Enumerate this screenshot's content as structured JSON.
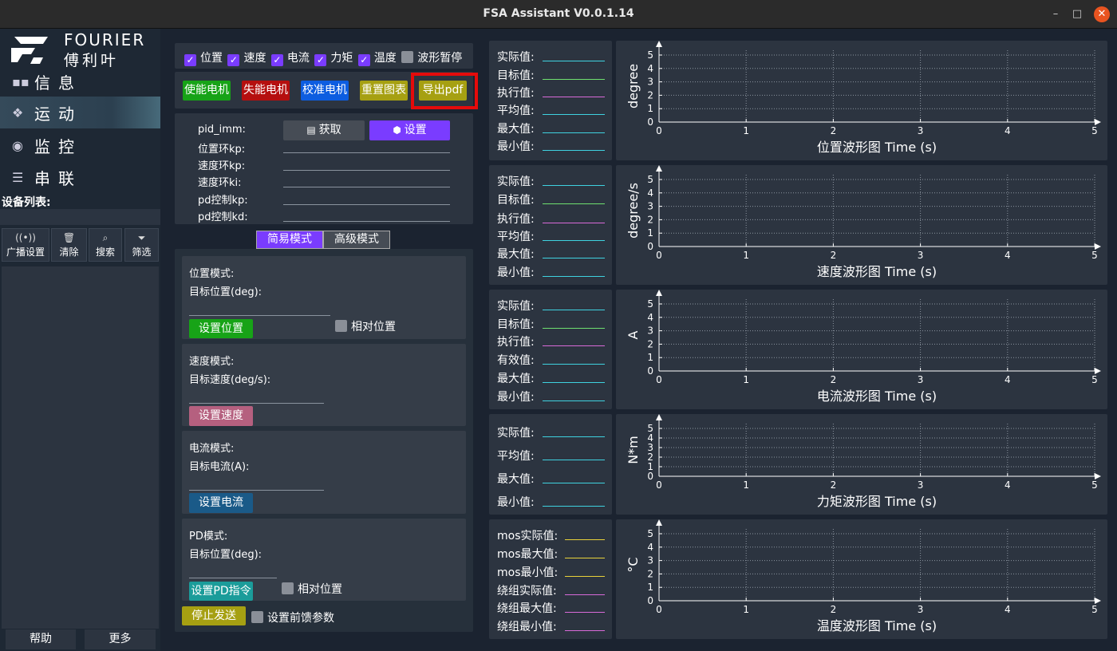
{
  "window": {
    "title": "FSA Assistant V0.0.1.14",
    "minimize": "–",
    "maximize": "□",
    "close": "✕"
  },
  "logo": {
    "brand": "FOURIER",
    "brand_cn": "傅利叶"
  },
  "nav": [
    {
      "icon": "grid-icon",
      "label": "信息",
      "active": false
    },
    {
      "icon": "motion-icon",
      "label": "运动",
      "active": true
    },
    {
      "icon": "monitor-icon",
      "label": "监控",
      "active": false
    },
    {
      "icon": "sliders-icon",
      "label": "串联",
      "active": false
    }
  ],
  "device_list": {
    "label": "设备列表:"
  },
  "side_buttons": [
    {
      "icon": "broadcast-icon",
      "label": "广播设置"
    },
    {
      "icon": "trash-icon",
      "label": "清除"
    },
    {
      "icon": "search-icon",
      "label": "搜索"
    },
    {
      "icon": "filter-icon",
      "label": "筛选"
    }
  ],
  "bottom_buttons": {
    "help": "帮助",
    "more": "更多"
  },
  "wave_toggles": [
    {
      "label": "位置",
      "checked": true
    },
    {
      "label": "速度",
      "checked": true
    },
    {
      "label": "电流",
      "checked": true
    },
    {
      "label": "力矩",
      "checked": true
    },
    {
      "label": "温度",
      "checked": true
    },
    {
      "label": "波形暂停",
      "checked": false
    }
  ],
  "motor_buttons": [
    {
      "label": "使能电机",
      "color": "#17a317"
    },
    {
      "label": "失能电机",
      "color": "#b50f0f"
    },
    {
      "label": "校准电机",
      "color": "#0d5de0"
    },
    {
      "label": "重置图表",
      "color": "#a6a012"
    },
    {
      "label": "导出pdf",
      "color": "#a6a012"
    }
  ],
  "pid": {
    "fields": [
      "pid_imm:",
      "位置环kp:",
      "速度环kp:",
      "速度环ki:",
      "pd控制kp:",
      "pd控制kd:"
    ],
    "get_label": "获取",
    "set_label": "设置"
  },
  "mode_tabs": {
    "simple": "简易模式",
    "advanced": "高级模式"
  },
  "modes": {
    "position": {
      "title": "位置模式:",
      "target": "目标位置(deg):",
      "button": "设置位置",
      "relative": "相对位置"
    },
    "velocity": {
      "title": "速度模式:",
      "target": "目标速度(deg/s):",
      "button": "设置速度"
    },
    "current": {
      "title": "电流模式:",
      "target": "目标电流(A):",
      "button": "设置电流"
    },
    "pd": {
      "title": "PD模式:",
      "target": "目标位置(deg):",
      "button": "设置PD指令",
      "relative": "相对位置"
    }
  },
  "footer_controls": {
    "stop": "停止发送",
    "feedforward": "设置前馈参数"
  },
  "stat_panels": [
    {
      "rows": [
        {
          "label": "实际值:",
          "color": "#3fd2e0"
        },
        {
          "label": "目标值:",
          "color": "#6fe070"
        },
        {
          "label": "执行值:",
          "color": "#d96ad9"
        },
        {
          "label": "平均值:",
          "color": "#3fd2e0"
        },
        {
          "label": "最大值:",
          "color": "#3fd2e0"
        },
        {
          "label": "最小值:",
          "color": "#3fd2e0"
        }
      ]
    },
    {
      "rows": [
        {
          "label": "实际值:",
          "color": "#3fd2e0"
        },
        {
          "label": "目标值:",
          "color": "#6fe070"
        },
        {
          "label": "执行值:",
          "color": "#d96ad9"
        },
        {
          "label": "平均值:",
          "color": "#3fd2e0"
        },
        {
          "label": "最大值:",
          "color": "#3fd2e0"
        },
        {
          "label": "最小值:",
          "color": "#3fd2e0"
        }
      ]
    },
    {
      "rows": [
        {
          "label": "实际值:",
          "color": "#3fd2e0"
        },
        {
          "label": "目标值:",
          "color": "#6fe070"
        },
        {
          "label": "执行值:",
          "color": "#d96ad9"
        },
        {
          "label": "有效值:",
          "color": "#3fd2e0"
        },
        {
          "label": "最大值:",
          "color": "#3fd2e0"
        },
        {
          "label": "最小值:",
          "color": "#3fd2e0"
        }
      ]
    },
    {
      "rows": [
        {
          "label": "实际值:",
          "color": "#3fd2e0"
        },
        {
          "label": "平均值:",
          "color": "#3fd2e0"
        },
        {
          "label": "最大值:",
          "color": "#3fd2e0"
        },
        {
          "label": "最小值:",
          "color": "#3fd2e0"
        }
      ]
    },
    {
      "rows": [
        {
          "label": "mos实际值:",
          "color": "#e8d23a"
        },
        {
          "label": "mos最大值:",
          "color": "#e8d23a"
        },
        {
          "label": "mos最小值:",
          "color": "#e8d23a"
        },
        {
          "label": "绕组实际值:",
          "color": "#d96ad9"
        },
        {
          "label": "绕组最大值:",
          "color": "#d96ad9"
        },
        {
          "label": "绕组最小值:",
          "color": "#d96ad9"
        }
      ]
    }
  ],
  "chart_data": [
    {
      "type": "line",
      "title": "位置波形图 Time (s)",
      "ylabel": "degree",
      "xlim": [
        0,
        5
      ],
      "ylim": [
        0,
        5
      ],
      "xticks": [
        0,
        1,
        2,
        3,
        4,
        5
      ],
      "yticks": [
        0,
        1,
        2,
        3,
        4,
        5
      ],
      "grid": true,
      "series": []
    },
    {
      "type": "line",
      "title": "速度波形图 Time (s)",
      "ylabel": "degree/s",
      "xlim": [
        0,
        5
      ],
      "ylim": [
        0,
        5
      ],
      "xticks": [
        0,
        1,
        2,
        3,
        4,
        5
      ],
      "yticks": [
        0,
        1,
        2,
        3,
        4,
        5
      ],
      "grid": true,
      "series": []
    },
    {
      "type": "line",
      "title": "电流波形图 Time (s)",
      "ylabel": "A",
      "xlim": [
        0,
        5
      ],
      "ylim": [
        0,
        5
      ],
      "xticks": [
        0,
        1,
        2,
        3,
        4,
        5
      ],
      "yticks": [
        0,
        1,
        2,
        3,
        4,
        5
      ],
      "grid": true,
      "series": []
    },
    {
      "type": "line",
      "title": "力矩波形图 Time (s)",
      "ylabel": "N*m",
      "xlim": [
        0,
        5
      ],
      "ylim": [
        0,
        5
      ],
      "xticks": [
        0,
        1,
        2,
        3,
        4,
        5
      ],
      "yticks": [
        0,
        1,
        2,
        3,
        4,
        5
      ],
      "grid": true,
      "series": []
    },
    {
      "type": "line",
      "title": "温度波形图 Time (s)",
      "ylabel": "°C",
      "xlim": [
        0,
        5
      ],
      "ylim": [
        0,
        5
      ],
      "xticks": [
        0,
        1,
        2,
        3,
        4,
        5
      ],
      "yticks": [
        0,
        1,
        2,
        3,
        4,
        5
      ],
      "grid": true,
      "series": []
    }
  ]
}
